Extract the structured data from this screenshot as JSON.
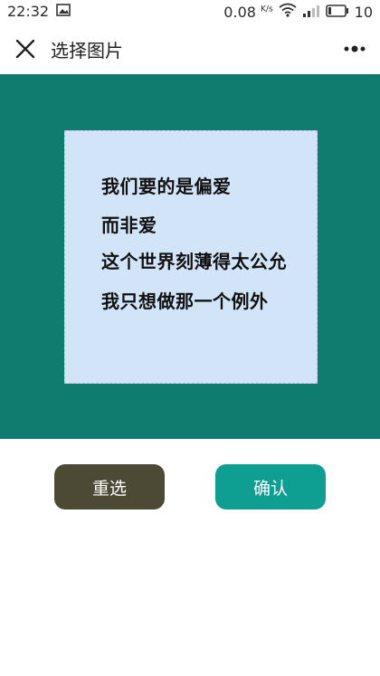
{
  "status_bar": {
    "time": "22:32",
    "speed": "0.08",
    "speed_unit": "K/s",
    "battery": "10"
  },
  "header": {
    "title": "选择图片",
    "close_icon": "close-icon",
    "more_icon": "more-dots-icon"
  },
  "image_preview": {
    "background_color": "#0f7c6f",
    "image_color": "#d2e4f8",
    "lines": [
      "我们要的是偏爱",
      "而非爱",
      "这个世界刻薄得太公允",
      "我只想做那一个例外"
    ]
  },
  "actions": {
    "reselect_label": "重选",
    "confirm_label": "确认",
    "reselect_color": "#4c4a35",
    "confirm_color": "#0f9e92"
  }
}
